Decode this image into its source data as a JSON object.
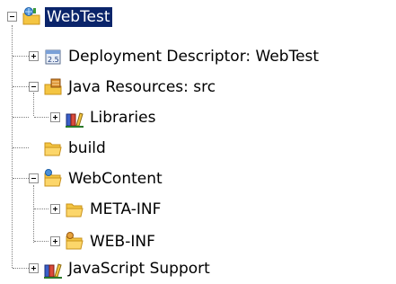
{
  "tree": {
    "root": {
      "label": "WebTest",
      "expanded": true,
      "selected": true,
      "icon": "web-project-icon"
    },
    "children": [
      {
        "label": "Deployment Descriptor: WebTest",
        "expanded": false,
        "icon": "deployment-descriptor-icon"
      },
      {
        "label": "Java Resources: src",
        "expanded": true,
        "icon": "java-resources-icon",
        "children": [
          {
            "label": "Libraries",
            "expanded": false,
            "icon": "libraries-icon"
          }
        ]
      },
      {
        "label": "build",
        "expanded": null,
        "icon": "folder-icon"
      },
      {
        "label": "WebContent",
        "expanded": true,
        "icon": "web-content-folder-icon",
        "children": [
          {
            "label": "META-INF",
            "expanded": false,
            "icon": "folder-icon"
          },
          {
            "label": "WEB-INF",
            "expanded": false,
            "icon": "web-inf-folder-icon"
          }
        ]
      },
      {
        "label": "JavaScript Support",
        "expanded": false,
        "icon": "libraries-icon"
      }
    ]
  },
  "colors": {
    "selection": "#0a246a",
    "selection_text": "#ffffff",
    "folder": "#f4c542",
    "folder_dark": "#c9921a"
  }
}
